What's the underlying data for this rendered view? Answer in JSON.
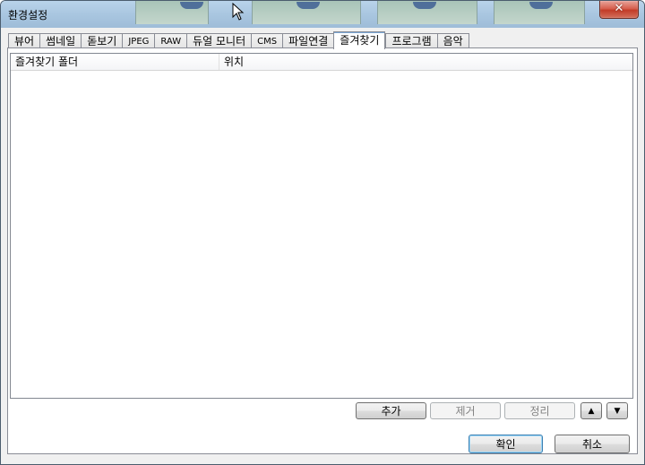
{
  "window": {
    "title": "환경설정",
    "close_label": "✕"
  },
  "tabs": [
    {
      "label": "뷰어",
      "active": false
    },
    {
      "label": "썸네일",
      "active": false
    },
    {
      "label": "돋보기",
      "active": false
    },
    {
      "label": "JPEG",
      "active": false
    },
    {
      "label": "RAW",
      "active": false
    },
    {
      "label": "듀얼 모니터",
      "active": false
    },
    {
      "label": "CMS",
      "active": false
    },
    {
      "label": "파일연결",
      "active": false
    },
    {
      "label": "즐겨찾기",
      "active": true
    },
    {
      "label": "프로그램",
      "active": false
    },
    {
      "label": "음악",
      "active": false
    }
  ],
  "favorites_list": {
    "columns": [
      "즐겨찾기 폴더",
      "위치"
    ],
    "rows": []
  },
  "list_buttons": {
    "add": "추가",
    "remove": "제거",
    "sort": "정리",
    "up": "▲",
    "down": "▼"
  },
  "dialog_buttons": {
    "ok": "확인",
    "cancel": "취소"
  }
}
